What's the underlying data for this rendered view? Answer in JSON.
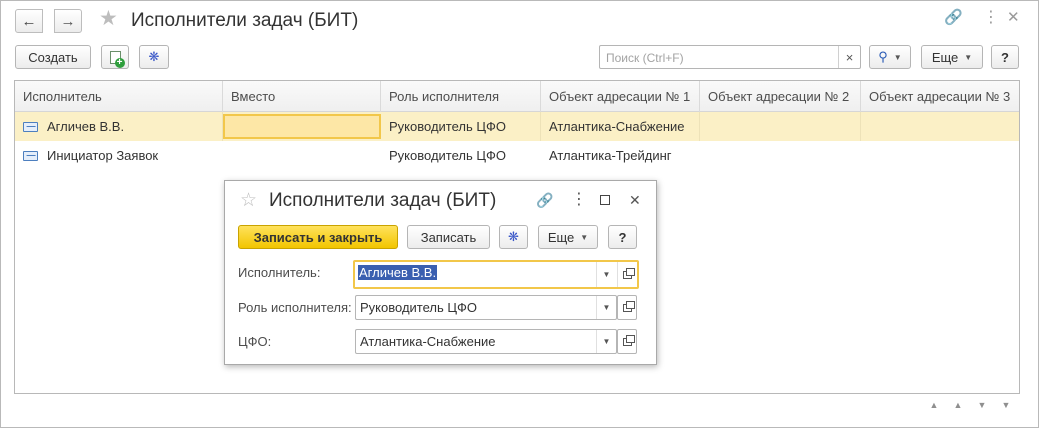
{
  "window": {
    "title": "Исполнители задач (БИТ)",
    "nav_back": "🡐",
    "nav_forward": "🡒",
    "link_icon": "link-icon",
    "more_icon": "more-vertical-icon",
    "close_icon": "close-icon"
  },
  "toolbar": {
    "create_label": "Создать",
    "search_placeholder": "Поиск (Ctrl+F)",
    "search_clear": "×",
    "more_label": "Еще",
    "help_label": "?"
  },
  "table": {
    "columns": [
      "Исполнитель",
      "Вместо",
      "Роль исполнителя",
      "Объект адресации № 1",
      "Объект адресации № 2",
      "Объект адресации № 3"
    ],
    "rows": [
      {
        "performer": "Агличев В.В.",
        "instead": "",
        "role": "Руководитель ЦФО",
        "obj1": "Атлантика-Снабжение",
        "obj2": "",
        "obj3": "",
        "selected": true
      },
      {
        "performer": "Инициатор Заявок",
        "instead": "",
        "role": "Руководитель ЦФО",
        "obj1": "Атлантика-Трейдинг",
        "obj2": "",
        "obj3": "",
        "selected": false
      }
    ]
  },
  "dialog": {
    "title": "Исполнители задач (БИТ)",
    "save_close_label": "Записать и закрыть",
    "save_label": "Записать",
    "more_label": "Еще",
    "help_label": "?",
    "fields": [
      {
        "label": "Исполнитель:",
        "value": "Агличев В.В."
      },
      {
        "label": "Роль исполнителя:",
        "value": "Руководитель ЦФО"
      },
      {
        "label": "ЦФО:",
        "value": "Атлантика-Снабжение"
      }
    ]
  },
  "colors": {
    "accent_yellow": "#f2c500",
    "selected_row": "#fbf0c6",
    "active_cell": "#fde7a6",
    "text_highlight": "#3a5fb0"
  }
}
